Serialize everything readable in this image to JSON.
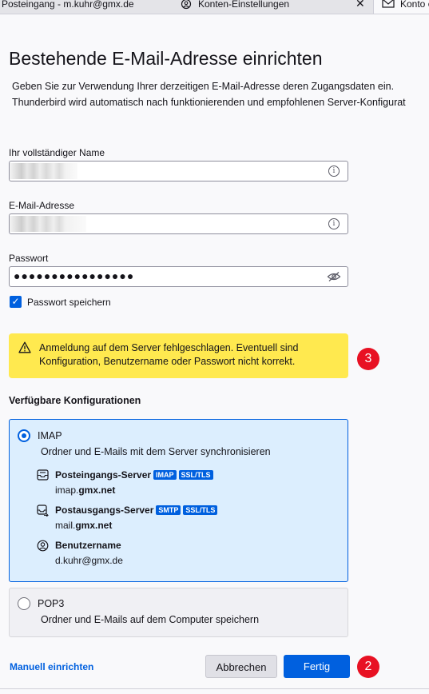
{
  "tabs": [
    {
      "label": "Posteingang - m.kuhr@gmx.de"
    },
    {
      "label": "Konten-Einstellungen",
      "close": "✕",
      "icon": "account-settings-icon"
    },
    {
      "label": "Konto e",
      "icon": "mail-icon"
    }
  ],
  "page": {
    "title": "Bestehende E-Mail-Adresse einrichten",
    "intro_line1": "Geben Sie zur Verwendung Ihrer derzeitigen E-Mail-Adresse deren Zugangsdaten ein.",
    "intro_line2": "Thunderbird wird automatisch nach funktionierenden und empfohlenen Server-Konfigurat"
  },
  "form": {
    "name_label": "Ihr vollständiger Name",
    "email_label": "E-Mail-Adresse",
    "password_label": "Passwort",
    "password_value": "●●●●●●●●●●●●●●●●",
    "remember_password_label": "Passwort speichern",
    "remember_password_checked": true
  },
  "warning": {
    "line1": "Anmeldung auf dem Server fehlgeschlagen. Eventuell sind",
    "line2": "Konfiguration, Benutzername oder Passwort nicht korrekt."
  },
  "configs": {
    "heading": "Verfügbare Konfigurationen",
    "imap": {
      "name": "IMAP",
      "description": "Ordner und E-Mails mit dem Server synchronisieren",
      "selected": true,
      "incoming_label": "Posteingangs-Server",
      "incoming_badges": [
        "IMAP",
        "SSL/TLS"
      ],
      "incoming_host_prefix": "imap.",
      "incoming_host_domain": "gmx.net",
      "outgoing_label": "Postausgangs-Server",
      "outgoing_badges": [
        "SMTP",
        "SSL/TLS"
      ],
      "outgoing_host_prefix": "mail.",
      "outgoing_host_domain": "gmx.net",
      "username_label": "Benutzername",
      "username_value": "d.kuhr@gmx.de"
    },
    "pop3": {
      "name": "POP3",
      "description": "Ordner und E-Mails auf dem Computer speichern",
      "selected": false
    }
  },
  "footer": {
    "manual_link": "Manuell einrichten",
    "cancel_label": "Abbrechen",
    "done_label": "Fertig"
  },
  "annotations": {
    "warning_step": "3",
    "done_step": "2"
  },
  "colors": {
    "accent": "#0060df",
    "warning_bg": "#ffe94f",
    "selected_config_bg": "#dceefe",
    "step_badge": "#e81123"
  }
}
